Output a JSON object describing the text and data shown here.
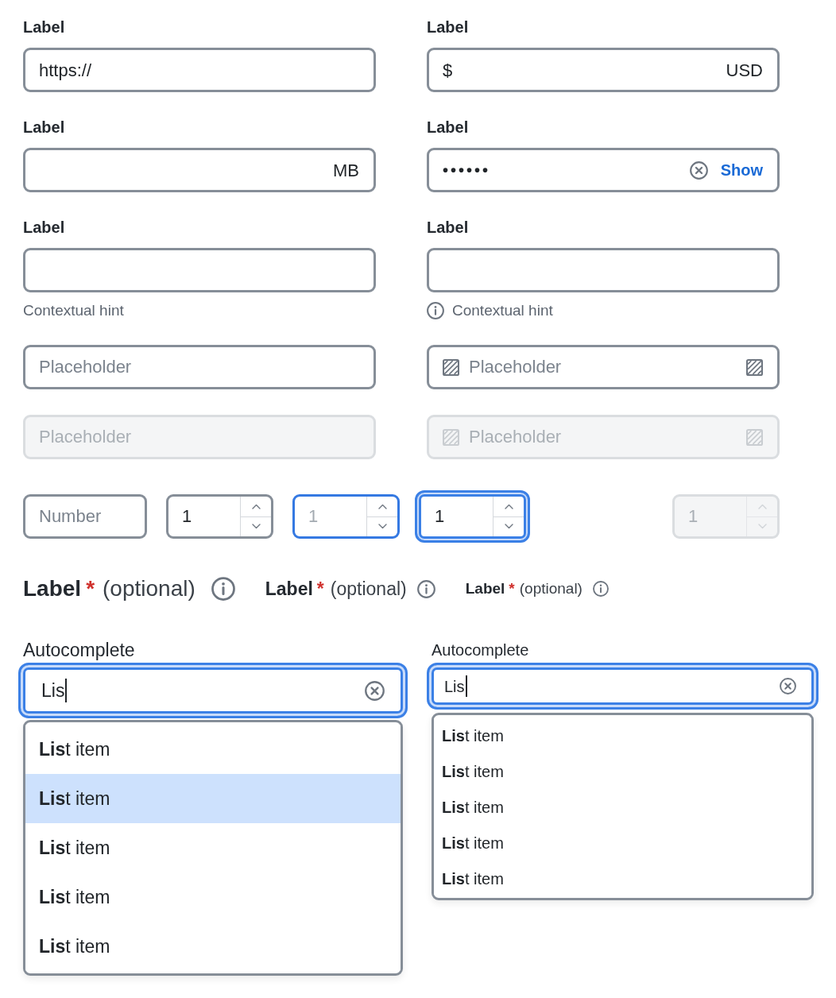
{
  "form_fields": [
    {
      "label": "Label",
      "prefix": "https://",
      "disabled": false
    },
    {
      "label": "Label",
      "prefix": "$",
      "suffix": "USD",
      "disabled": false
    },
    {
      "label": "Label",
      "suffix": "MB",
      "disabled": false
    },
    {
      "label": "Label",
      "value": "••••••",
      "clear_button": true,
      "action": "Show",
      "disabled": false
    },
    {
      "label": "Label",
      "hint": "Contextual hint",
      "disabled": false
    },
    {
      "label": "Label",
      "hint": "Contextual hint",
      "hint_icon": true,
      "disabled": false
    },
    {
      "placeholder": "Placeholder",
      "disabled": false
    },
    {
      "placeholder": "Placeholder",
      "leading_icon": true,
      "trailing_icon": true,
      "disabled": false
    },
    {
      "placeholder": "Placeholder",
      "disabled": true
    },
    {
      "placeholder": "Placeholder",
      "leading_icon": true,
      "trailing_icon": true,
      "disabled": true
    }
  ],
  "number_fields": [
    {
      "kind": "plain",
      "placeholder": "Number",
      "hovered": false,
      "focused": false,
      "disabled": false
    },
    {
      "kind": "stepper",
      "value": "1",
      "hovered": false,
      "focused": false,
      "disabled": false
    },
    {
      "kind": "stepper",
      "placeholder": "1",
      "hovered": true,
      "focused": false,
      "disabled": false
    },
    {
      "kind": "stepper",
      "value": "1",
      "hovered": false,
      "focused": true,
      "disabled": false
    },
    {
      "kind": "stepper",
      "value": "1",
      "hovered": false,
      "focused": false,
      "disabled": true
    }
  ],
  "label_samples": [
    {
      "kind": "large",
      "label": "Label",
      "required": "*",
      "optional": "(optional)"
    },
    {
      "kind": "medium",
      "label": "Label",
      "required": "*",
      "optional": "(optional)"
    },
    {
      "kind": "small",
      "label": "Label",
      "required": "*",
      "optional": "(optional)"
    }
  ],
  "autocompletes": [
    {
      "kind": "large",
      "label": "Autocomplete",
      "value": "Lis",
      "focused": true,
      "clear_button": true,
      "options": [
        {
          "text": "**Lis**t item",
          "selected": false
        },
        {
          "text": "**Lis**t item",
          "selected": true
        },
        {
          "text": "**Lis**t item",
          "selected": false
        },
        {
          "text": "**Lis**t item",
          "selected": false
        },
        {
          "text": "**Lis**t item",
          "selected": false
        }
      ]
    },
    {
      "kind": "small",
      "label": "Autocomplete",
      "value": "Lis",
      "focused": true,
      "clear_button": true,
      "options": [
        {
          "text": "**Lis**t item",
          "selected": false
        },
        {
          "text": "**Lis**t item",
          "selected": false
        },
        {
          "text": "**Lis**t item",
          "selected": false
        },
        {
          "text": "**Lis**t item",
          "selected": false
        },
        {
          "text": "**Lis**t item",
          "selected": false
        }
      ]
    }
  ]
}
